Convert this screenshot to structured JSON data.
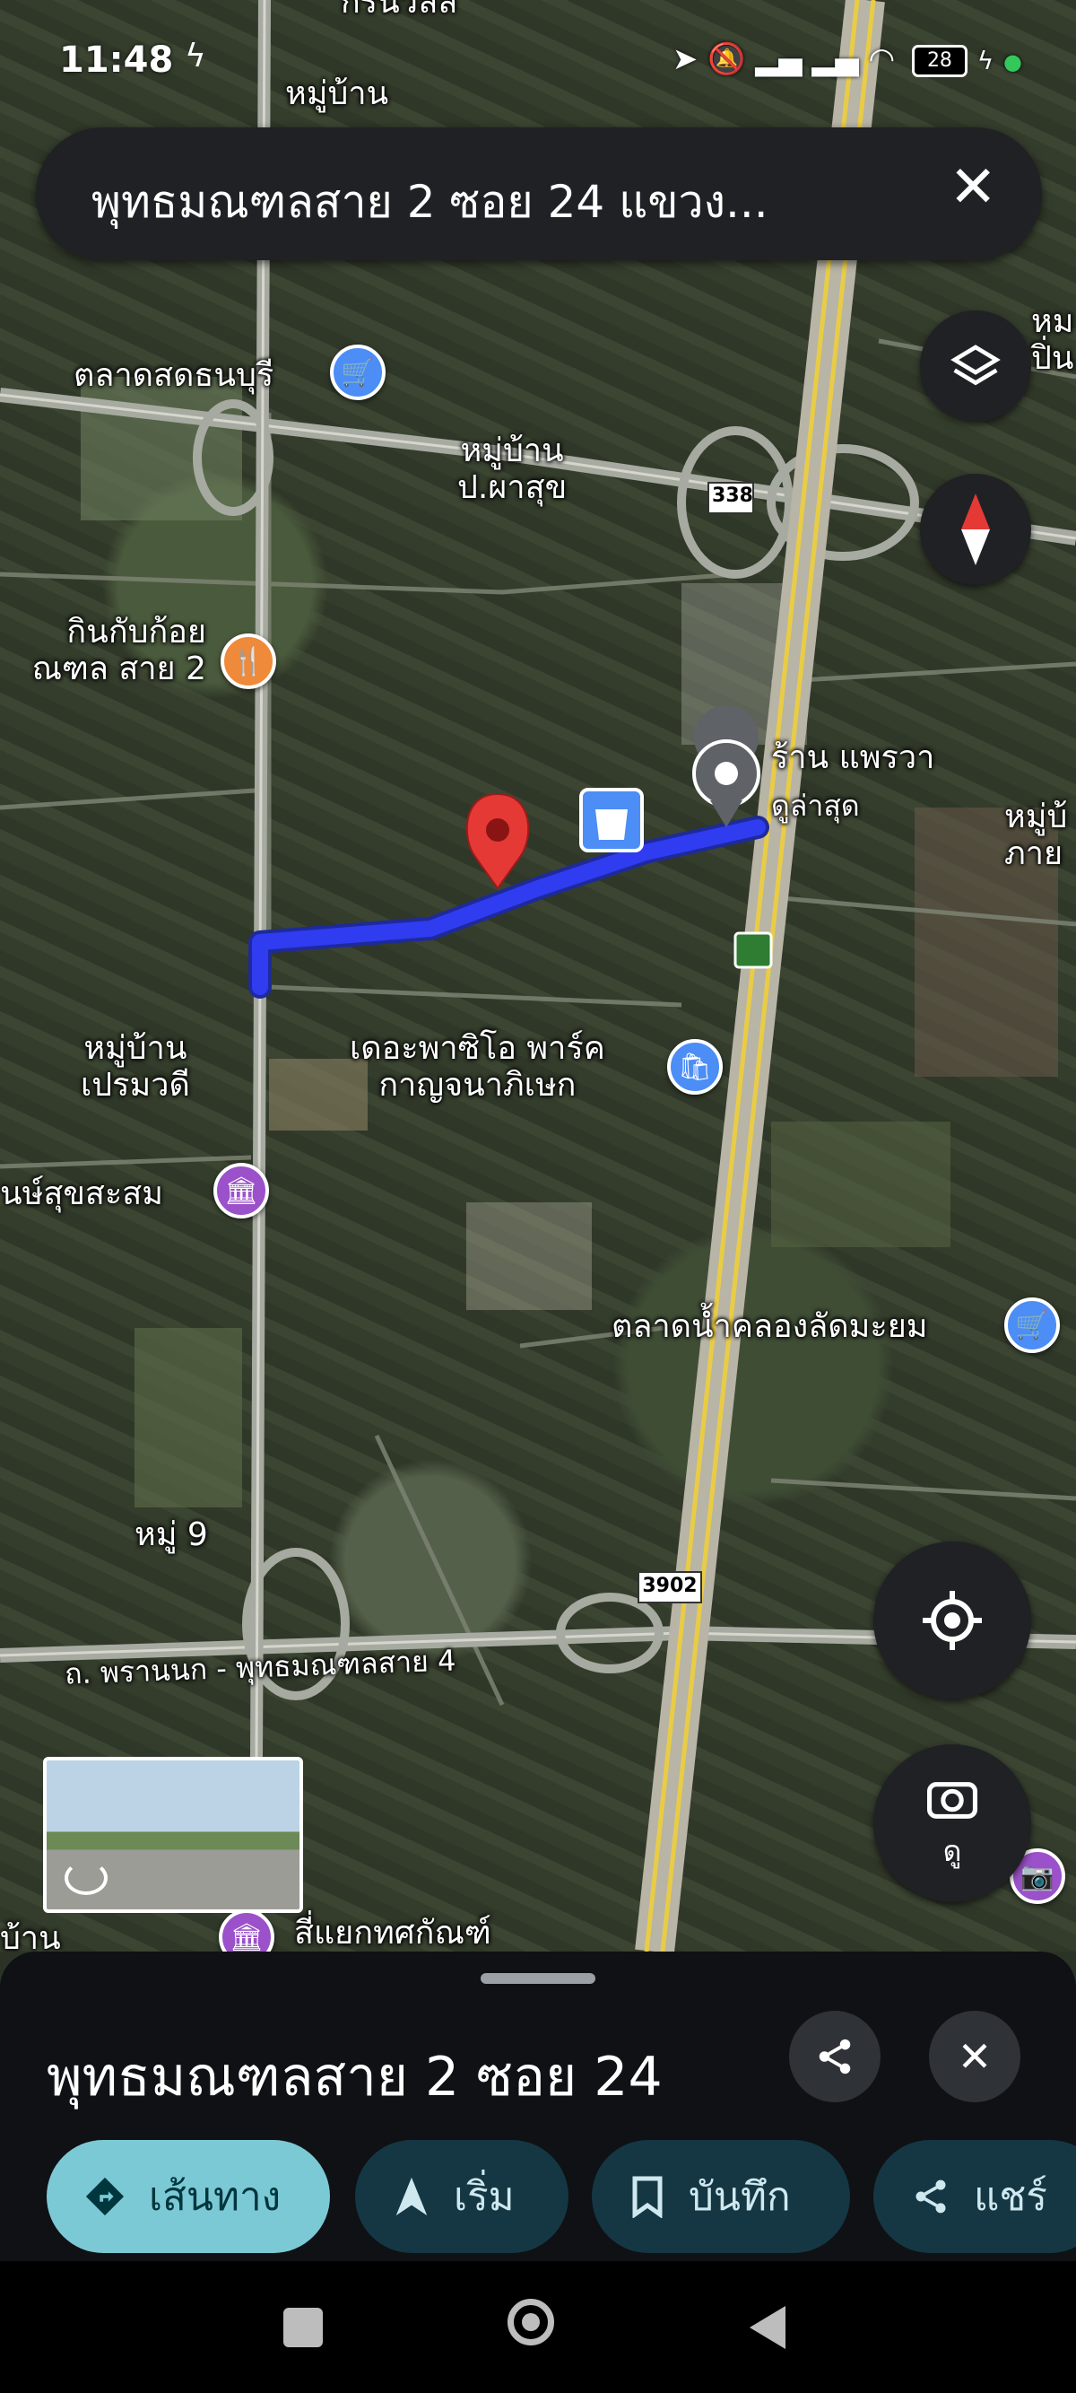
{
  "status_bar": {
    "time": "11:48",
    "battery": "28"
  },
  "search": {
    "query": "พุทธมณฑลสาย 2 ซอย 24 แขวง..."
  },
  "map": {
    "labels": {
      "top_cut": "กรีนวิลล",
      "village_top": "หมู่บ้าน",
      "market_thonburi": "ตลาดสดธนบุรี",
      "village_phasuk": "หมู่บ้าน\nป.ผาสุข",
      "right_top": "หม\nปิ่น",
      "kinkap": "กินกับก้อย\nณฑล สาย 2",
      "shop": "ร้าน แพรวา",
      "recent": "ดูล่าสุด",
      "right_mid": "หมู่บ้\nภาย",
      "prammawadee": "หมู่บ้าน\nเปรมวดี",
      "the_paseo": "เดอะพาซิโอ พาร์ค\nกาญจนาภิเษก",
      "museum": "นษ์สุขสะสม",
      "floating_market": "ตลาดน้ำคลองลัดมะยม",
      "moo9": "หมู่ 9",
      "road_phranok": "ถ. พรานนก - พุทธมณฑลสาย 4",
      "junction": "สี่แยกทศกัณฑ์",
      "left_bottom": "บ้าน"
    },
    "shields": {
      "route_338": "338",
      "route_3902": "3902"
    },
    "street_view_label": "ดู"
  },
  "place_sheet": {
    "title": "พุทธมณฑลสาย 2 ซอย 24",
    "buttons": {
      "directions": "เส้นทาง",
      "start": "เริ่ม",
      "save": "บันทึก",
      "share": "แชร์"
    }
  },
  "colors": {
    "route": "#2f3cf0",
    "pin_red": "#e53935",
    "sheet_bg": "#0f1115",
    "chip_primary": "#7cc9d6",
    "chip": "#143743"
  }
}
